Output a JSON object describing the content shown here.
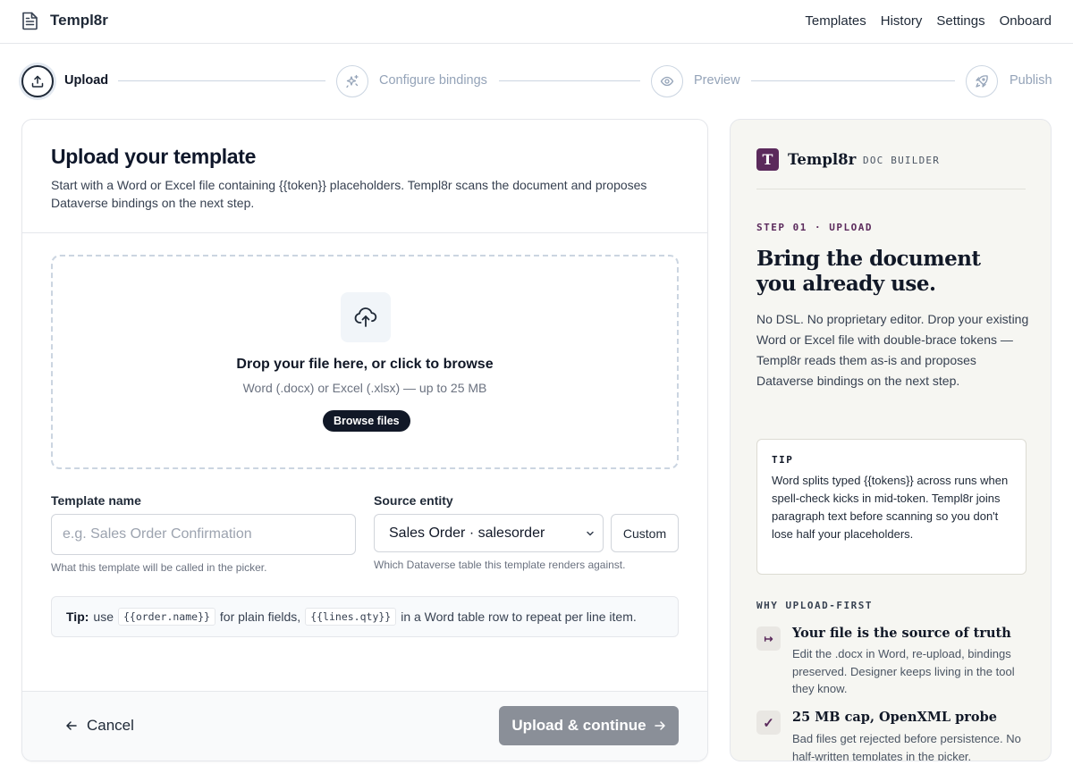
{
  "app": {
    "name": "Templ8r"
  },
  "nav": [
    "Templates",
    "History",
    "Settings",
    "Onboard"
  ],
  "steps": [
    {
      "label": "Upload",
      "icon": "upload-icon",
      "active": true
    },
    {
      "label": "Configure bindings",
      "icon": "sparkles-icon",
      "active": false
    },
    {
      "label": "Preview",
      "icon": "eye-icon",
      "active": false
    },
    {
      "label": "Publish",
      "icon": "rocket-icon",
      "active": false
    }
  ],
  "main": {
    "title": "Upload your template",
    "description": "Start with a Word or Excel file containing {{token}} placeholders. Templ8r scans the document and proposes Dataverse bindings on the next step.",
    "dropzone": {
      "title": "Drop your file here, or click to browse",
      "subtitle": "Word (.docx) or Excel (.xlsx) — up to 25 MB",
      "browse_label": "Browse files"
    },
    "template_name": {
      "label": "Template name",
      "placeholder": "e.g. Sales Order Confirmation",
      "value": "",
      "hint": "What this template will be called in the picker."
    },
    "source_entity": {
      "label": "Source entity",
      "selected": "Sales Order · salesorder",
      "custom_label": "Custom",
      "hint": "Which Dataverse table this template renders against."
    },
    "tip": {
      "label": "Tip:",
      "pre": "use",
      "code1": "{{order.name}}",
      "mid": "for plain fields,",
      "code2": "{{lines.qty}}",
      "post": "in a Word table row to repeat per line item."
    },
    "footer": {
      "cancel_label": "Cancel",
      "submit_label": "Upload & continue"
    }
  },
  "panel": {
    "logo_letter": "T",
    "brand": "Templ8r",
    "tag": "DOC BUILDER",
    "step": "STEP 01 · UPLOAD",
    "title": "Bring the document you already use.",
    "body": "No DSL. No proprietary editor. Drop your existing Word or Excel file with double-brace tokens — Templ8r reads them as-is and proposes Dataverse bindings on the next step.",
    "tip_label": "TIP",
    "tip_text": "Word splits typed {{tokens}} across runs when spell-check kicks in mid-token. Templ8r joins paragraph text before scanning so you don't lose half your placeholders.",
    "why_label": "WHY UPLOAD-FIRST",
    "items": [
      {
        "icon": "↦",
        "title": "Your file is the source of truth",
        "text": "Edit the .docx in Word, re-upload, bindings preserved. Designer keeps living in the tool they know."
      },
      {
        "icon": "✓",
        "title": "25 MB cap, OpenXML probe",
        "text": "Bad files get rejected before persistence. No half-written templates in the picker."
      }
    ]
  },
  "colors": {
    "accent": "#5b2a5c",
    "primary_dark": "#111827",
    "disabled_button": "#8a8f98",
    "panel_bg": "#f6f6f2"
  }
}
